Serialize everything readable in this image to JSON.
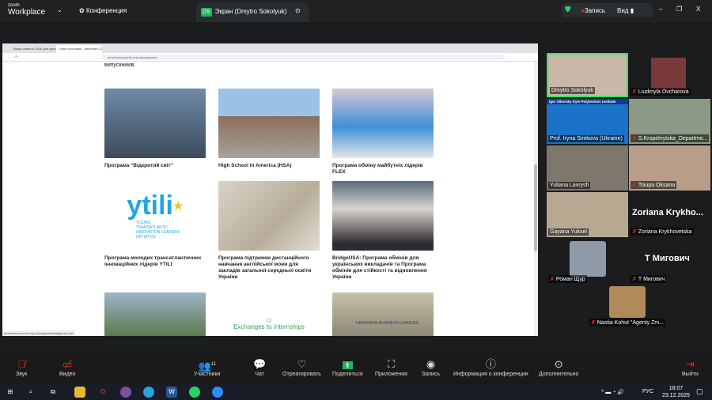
{
  "topbar": {
    "app_small": "zoom",
    "app_name": "Workplace",
    "meeting_label": "Конференция",
    "share_tab_initials": "DS",
    "share_tab_label": "Экран (Dmytro Sokolyuk)",
    "record_label": "Запись",
    "view_label": "Вид"
  },
  "browser": {
    "tabs": [
      "Вища освіта в США для укра...",
      "Наші програми - American Co..."
    ],
    "url": "americancouncils.org.ua/programs/",
    "status_url": "americancouncils.org.ua/programs/bridgeusa-ukr/"
  },
  "page": {
    "intro_text": "випускників.",
    "cards": [
      {
        "caption": "Програма “Відкритий світ”"
      },
      {
        "caption": "High School in America (HSA)"
      },
      {
        "caption": "Програма обміну майбутніх лідерів FLEX"
      },
      {
        "caption": "Програма молодих трансатлантичних інноваційних лідерів YTILI",
        "logo_text": "ytili",
        "logo_sub": "YOUNG TRANSATLANTIC INNOVATION LEADERS INITIATIVE"
      },
      {
        "caption": "Програма підтримки дистанційного навчання англійської мови для закладів загальної середньої освіти України"
      },
      {
        "caption": "BridgeUSA: Програма обмінів для українських викладачів та Програма обмінів для стійкості та відновлення України"
      },
      {
        "caption": ""
      },
      {
        "caption": "",
        "overlay": "Exchanges to Internships"
      },
      {
        "caption": "",
        "overlay": "UKRAINIAN BUSINESS LEADERS"
      }
    ]
  },
  "participants": [
    {
      "name": "Dmytro Sokolyuk",
      "muted": false,
      "active": true
    },
    {
      "name": "Liudmyla Ovcharova",
      "muted": true
    },
    {
      "name": "Prof. Iryna Simkova (Ukraine)",
      "muted": false,
      "banner": "Igor Sikorsky Kyiv Polytechnic Institute"
    },
    {
      "name": "S.Kropelnytska_Departme...",
      "muted": true
    },
    {
      "name": "Yuliana Lavrysh",
      "muted": false
    },
    {
      "name": "Tsiupa Oksana",
      "muted": true
    },
    {
      "name": "Gayana Yuksel",
      "muted": false
    },
    {
      "name": "Zoriana Krykhovetska",
      "muted": true,
      "display": "Zoriana Krykho..."
    },
    {
      "name": "Роман Щур",
      "muted": true
    },
    {
      "name": "Т Мигович",
      "muted": true,
      "display": "Т Мигович"
    },
    {
      "name": "Nastia Kohut \"Agenty Zm...",
      "muted": true
    }
  ],
  "toolbar": {
    "audio": "Звук",
    "video": "Видео",
    "participants": "Участники",
    "participants_count": "11",
    "chat": "Чат",
    "react": "Отреагировать",
    "share": "Поделиться",
    "apps": "Приложения",
    "record": "Запись",
    "info": "Информация о конференции",
    "more": "Дополнительно",
    "leave": "Выйти"
  },
  "taskbar": {
    "lang": "РУС",
    "time": "18:07",
    "date": "23.12.2025"
  },
  "colors": {
    "active_speaker": "#2ee86a",
    "record": "#e02828",
    "share_green": "#24b35a"
  }
}
